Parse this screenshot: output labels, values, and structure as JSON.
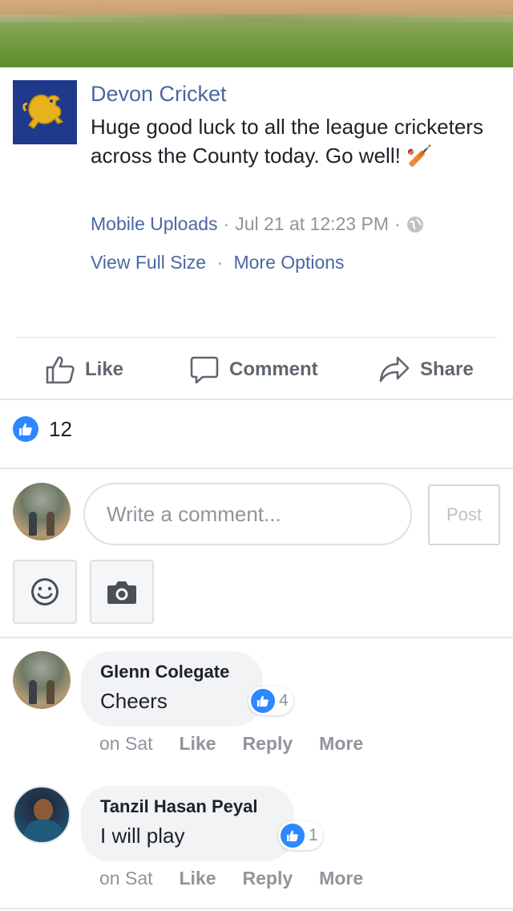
{
  "post": {
    "page_name": "Devon Cricket",
    "text": "Huge good luck to all the league cricketers across the County today. Go well! 🏏",
    "album": "Mobile Uploads",
    "timestamp": "Jul 21 at 12:23 PM",
    "visibility_icon": "globe-icon",
    "view_full_size": "View Full Size",
    "more_options": "More Options",
    "meta_separator": "·"
  },
  "actions": {
    "like": "Like",
    "comment": "Comment",
    "share": "Share"
  },
  "reactions": {
    "icon": "like-icon",
    "count": "12"
  },
  "composer": {
    "placeholder": "Write a comment...",
    "post_label": "Post",
    "emoji_icon": "smiley-icon",
    "camera_icon": "camera-icon"
  },
  "comments": [
    {
      "author": "Glenn Colegate",
      "text": "Cheers",
      "likes": "4",
      "time": "on Sat",
      "like_label": "Like",
      "reply_label": "Reply",
      "more_label": "More"
    },
    {
      "author": "Tanzil Hasan Peyal",
      "text": "I will play",
      "likes": "1",
      "time": "on Sat",
      "like_label": "Like",
      "reply_label": "Reply",
      "more_label": "More"
    }
  ],
  "colors": {
    "link_blue": "#4b67a1",
    "like_blue": "#2d88ff",
    "meta_gray": "#90949c",
    "bubble_bg": "#f2f3f5"
  }
}
